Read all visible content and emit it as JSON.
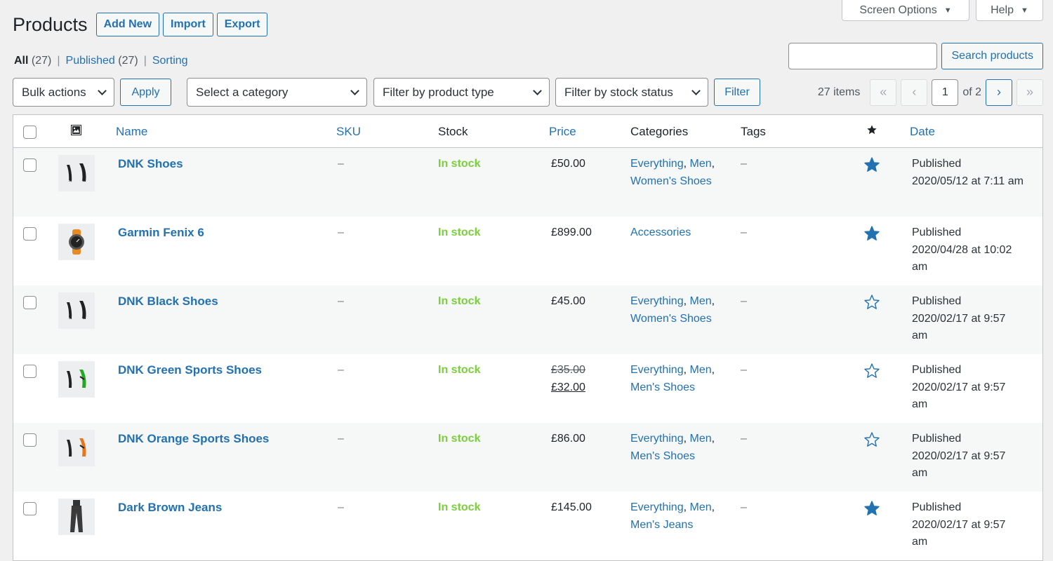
{
  "screen_meta": {
    "screen_options": "Screen Options",
    "help": "Help"
  },
  "header": {
    "title": "Products",
    "add_new": "Add New",
    "import": "Import",
    "export": "Export"
  },
  "views": [
    {
      "label": "All",
      "count": "(27)"
    },
    {
      "label": "Published",
      "count": "(27)"
    },
    {
      "label": "Sorting",
      "count": ""
    }
  ],
  "search": {
    "placeholder": "",
    "button": "Search products"
  },
  "tablenav": {
    "bulk_actions": "Bulk actions",
    "apply": "Apply",
    "category": "Select a category",
    "product_type": "Filter by product type",
    "stock_status": "Filter by stock status",
    "filter": "Filter",
    "items": "27 items",
    "current_page": "1",
    "of_pages": "of 2",
    "first": "«",
    "prev": "‹",
    "next": "›",
    "last": "»"
  },
  "columns": {
    "name": "Name",
    "sku": "SKU",
    "stock": "Stock",
    "price": "Price",
    "categories": "Categories",
    "tags": "Tags",
    "featured_icon": "star-icon",
    "date": "Date"
  },
  "rows": [
    {
      "name": "DNK Shoes",
      "sku": "–",
      "stock": "In stock",
      "price": "£50.00",
      "old_price": "",
      "cats": [
        "Everything",
        "Men",
        "Women's Shoes"
      ],
      "tags": "–",
      "featured": true,
      "date1": "Published",
      "date2": "2020/05/12 at 7:11 am",
      "date3": "",
      "thumb": "shoes"
    },
    {
      "name": "Garmin Fenix 6",
      "sku": "–",
      "stock": "In stock",
      "price": "£899.00",
      "old_price": "",
      "cats": [
        "Accessories"
      ],
      "tags": "–",
      "featured": true,
      "date1": "Published",
      "date2": "2020/04/28 at 10:02",
      "date3": "am",
      "thumb": "watch"
    },
    {
      "name": "DNK Black Shoes",
      "sku": "–",
      "stock": "In stock",
      "price": "£45.00",
      "old_price": "",
      "cats": [
        "Everything",
        "Men",
        "Women's Shoes"
      ],
      "tags": "–",
      "featured": false,
      "date1": "Published",
      "date2": "2020/02/17 at 9:57",
      "date3": "am",
      "thumb": "shoes"
    },
    {
      "name": "DNK Green Sports Shoes",
      "sku": "–",
      "stock": "In stock",
      "price": "£32.00",
      "old_price": "£35.00",
      "cats": [
        "Everything",
        "Men",
        "Men's Shoes"
      ],
      "tags": "–",
      "featured": false,
      "date1": "Published",
      "date2": "2020/02/17 at 9:57",
      "date3": "am",
      "thumb": "shoes-green"
    },
    {
      "name": "DNK Orange Sports Shoes",
      "sku": "–",
      "stock": "In stock",
      "price": "£86.00",
      "old_price": "",
      "cats": [
        "Everything",
        "Men",
        "Men's Shoes"
      ],
      "tags": "–",
      "featured": false,
      "date1": "Published",
      "date2": "2020/02/17 at 9:57",
      "date3": "am",
      "thumb": "shoes-orange"
    },
    {
      "name": "Dark Brown Jeans",
      "sku": "–",
      "stock": "In stock",
      "price": "£145.00",
      "old_price": "",
      "cats": [
        "Everything",
        "Men",
        "Men's Jeans"
      ],
      "tags": "–",
      "featured": true,
      "date1": "Published",
      "date2": "2020/02/17 at 9:57",
      "date3": "am",
      "thumb": "jeans"
    }
  ],
  "colors": {
    "link": "#2271b1",
    "in_stock": "#7ad03a",
    "background": "#f0f0f1"
  }
}
